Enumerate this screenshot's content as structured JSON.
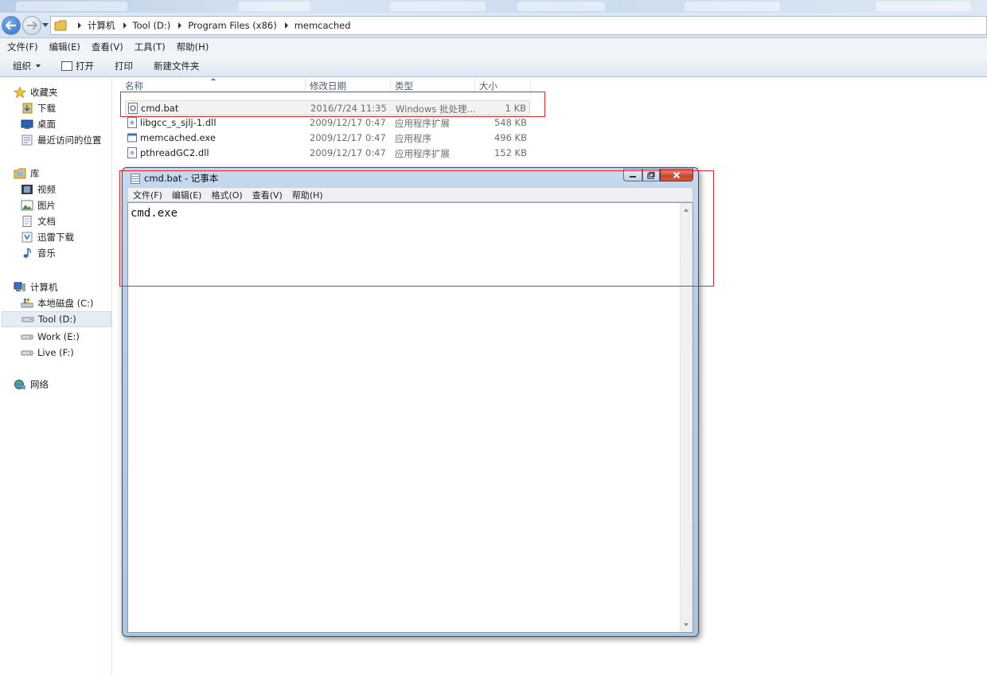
{
  "colors": {
    "accent": "#2c6ac4",
    "highlight_box": "#e0282e",
    "selected_row": "#f2f2f2"
  },
  "address_bar": {
    "breadcrumbs": [
      "计算机",
      "Tool (D:)",
      "Program Files (x86)",
      "memcached"
    ]
  },
  "menubar": {
    "items": [
      "文件(F)",
      "编辑(E)",
      "查看(V)",
      "工具(T)",
      "帮助(H)"
    ]
  },
  "toolbar": {
    "organize": "组织",
    "open": "打开",
    "print": "打印",
    "new_folder": "新建文件夹"
  },
  "nav": {
    "favorites": {
      "label": "收藏夹",
      "items": [
        "下载",
        "桌面",
        "最近访问的位置"
      ]
    },
    "libraries": {
      "label": "库",
      "items": [
        "视频",
        "图片",
        "文档",
        "迅雷下载",
        "音乐"
      ]
    },
    "computer": {
      "label": "计算机",
      "items": [
        "本地磁盘 (C:)",
        "Tool (D:)",
        "Work (E:)",
        "Live (F:)"
      ]
    },
    "network": {
      "label": "网络"
    }
  },
  "files": {
    "columns": [
      "名称",
      "修改日期",
      "类型",
      "大小"
    ],
    "rows": [
      {
        "name": "cmd.bat",
        "date": "2016/7/24 11:35",
        "type": "Windows 批处理...",
        "size": "1 KB",
        "icon": "batch-file-icon"
      },
      {
        "name": "libgcc_s_sjlj-1.dll",
        "date": "2009/12/17 0:47",
        "type": "应用程序扩展",
        "size": "548 KB",
        "icon": "dll-file-icon"
      },
      {
        "name": "memcached.exe",
        "date": "2009/12/17 0:47",
        "type": "应用程序",
        "size": "496 KB",
        "icon": "exe-file-icon"
      },
      {
        "name": "pthreadGC2.dll",
        "date": "2009/12/17 0:47",
        "type": "应用程序扩展",
        "size": "152 KB",
        "icon": "dll-file-icon"
      }
    ]
  },
  "notepad": {
    "title": "cmd.bat - 记事本",
    "menu": [
      "文件(F)",
      "编辑(E)",
      "格式(O)",
      "查看(V)",
      "帮助(H)"
    ],
    "content": "cmd.exe"
  }
}
